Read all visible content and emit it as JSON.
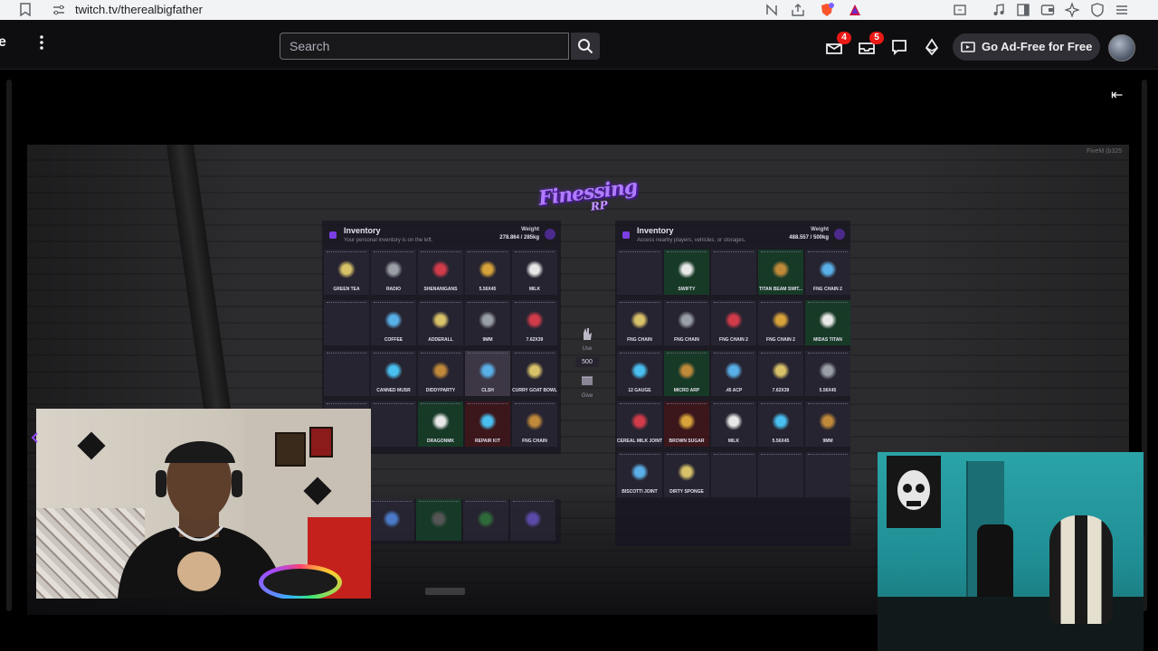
{
  "browser": {
    "url": "twitch.tv/therealbigfather"
  },
  "nav": {
    "edge_text": "e",
    "search_placeholder": "Search",
    "notifications_badge": "4",
    "whispers_badge": "5",
    "ad_free_label": "Go Ad-Free for Free"
  },
  "game": {
    "watermark": "FiveM (b325",
    "logo_line1": "Finessing",
    "logo_line2": "RP",
    "left_panel": {
      "title": "Inventory",
      "subtitle": "Your personal inventory is on the left.",
      "weight_label": "Weight",
      "weight_value": "278.864 / 285kg",
      "slots": [
        "GREEN TEA",
        "RADIO",
        "SHENANIGANS",
        "5.56X45",
        "MILK",
        "",
        "",
        "COFFEE",
        "ADDERALL",
        "9MM",
        "7.62X39",
        "",
        "",
        "CANNED MUSR",
        "DIDDYPARTY",
        "CLSH",
        "CURRY GOAT BOWL",
        "",
        "",
        "",
        "DRAGONMK",
        "REPAIR KIT",
        "FNG CHAIN",
        ""
      ]
    },
    "right_panel": {
      "title": "Inventory",
      "subtitle": "Access nearby players, vehicles, or storages.",
      "weight_label": "Weight",
      "weight_value": "488.557 / 500kg",
      "slots": [
        "",
        "SWIFTY",
        "",
        "TITAN BEAM SWIT...",
        "FNG CHAIN 2",
        "FNG CHAIN",
        "FNG CHAIN",
        "FNG CHAIN 2",
        "FNG CHAIN 2",
        "MIDAS TITAN",
        "12 GAUGE",
        "MICRO ARP",
        ".45 ACP",
        "7.62X39",
        "5.56X45",
        "CEREAL MILK JOINT",
        "BROWN SUGAR",
        "MILK",
        "5.56X45",
        "9MM",
        "BISCOTTI JOINT",
        "DIRTY SPONGE",
        "",
        "",
        ""
      ]
    },
    "hotbar": [
      "",
      "",
      "",
      ""
    ],
    "middle": {
      "use_label": "Use",
      "amount": "500",
      "give_label": "Give"
    }
  }
}
